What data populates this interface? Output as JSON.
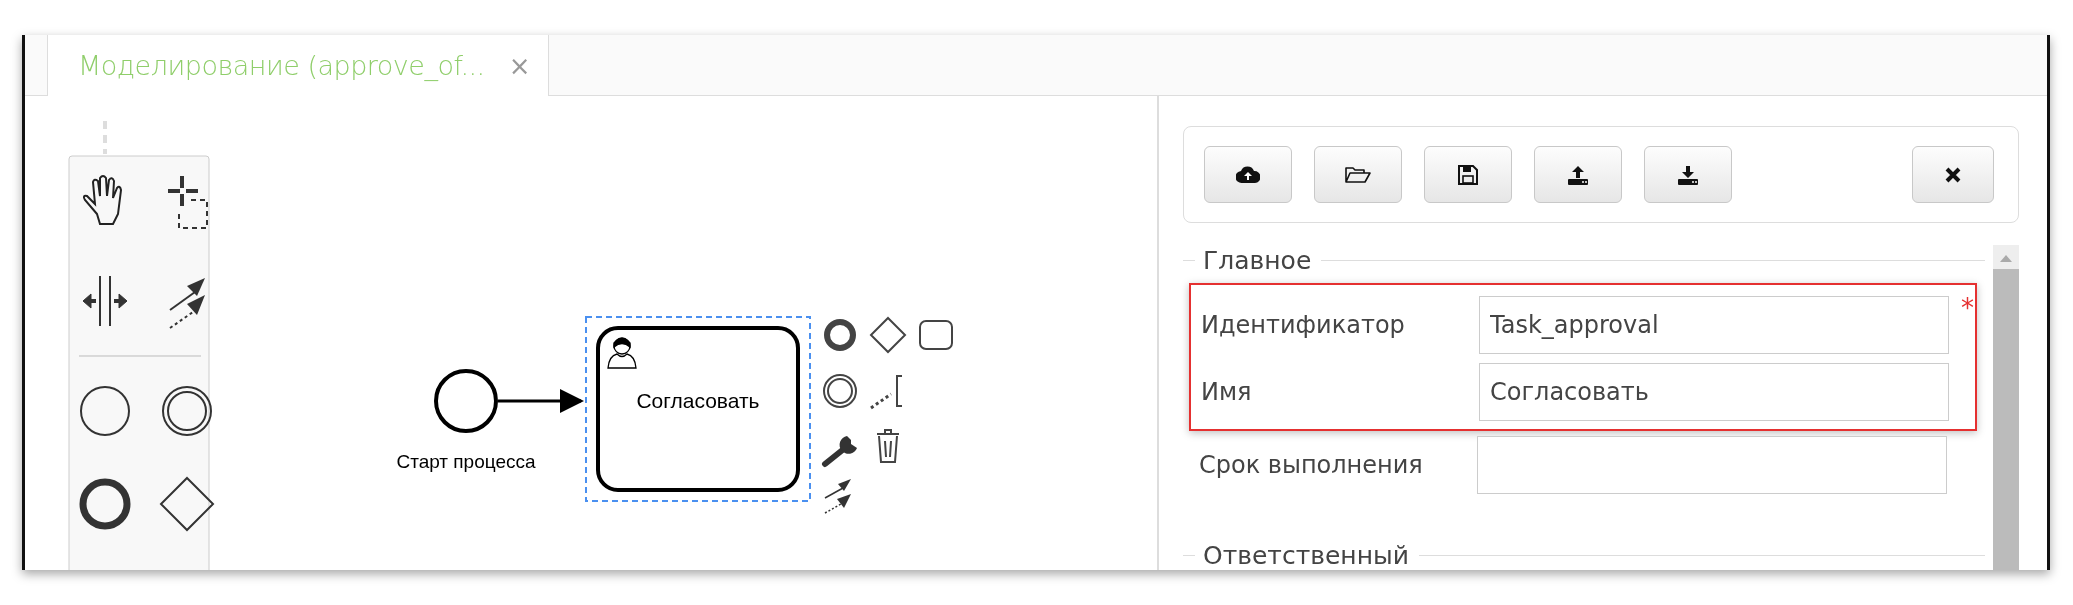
{
  "tab": {
    "label": "Моделирование (approve_of...",
    "close": "×"
  },
  "diagram": {
    "start_event": {
      "label": "Старт процесса"
    },
    "task": {
      "label": "Согласовать",
      "selected": true
    }
  },
  "properties": {
    "sections": [
      {
        "title": "Главное",
        "fields": [
          {
            "label": "Идентификатор",
            "value": "Task_approval",
            "required_mark": "*",
            "highlighted": true
          },
          {
            "label": "Имя",
            "value": "Согласовать",
            "highlighted": true
          },
          {
            "label": "Срок выполнения",
            "highlighted": false
          }
        ]
      },
      {
        "title": "Ответственный"
      }
    ]
  }
}
